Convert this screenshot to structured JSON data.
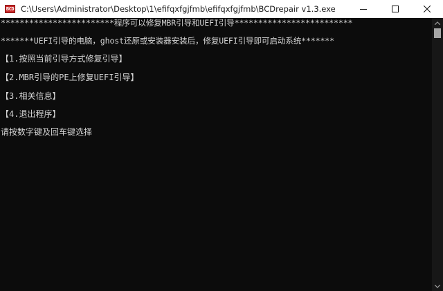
{
  "window": {
    "app_icon_text": "BCD",
    "title": "C:\\Users\\Administrator\\Desktop\\1\\efifqxfgjfmb\\efifqxfgjfmb\\BCDrepair v1.3.exe",
    "controls": {
      "minimize": "minimize-icon",
      "maximize": "maximize-icon",
      "close": "close-icon"
    }
  },
  "console": {
    "lines": [
      "************************程序可以修复MBR引导和UEFI引导*************************",
      "*******UEFI引导的电脑，ghost还原或安装器安装后，修复UEFI引导即可启动系统*******",
      "【1.按照当前引导方式修复引导】",
      "【2.MBR引导的PE上修复UEFI引导】",
      "【3.相关信息】",
      "【4.退出程序】",
      "请按数字键及回车键选择"
    ]
  },
  "colors": {
    "console_background": "#0c0c0c",
    "console_text": "#d4d4d4",
    "titlebar_background": "#ffffff",
    "scrollbar_track": "#171717",
    "scrollbar_thumb": "#a6a6a6",
    "icon_red": "#cc2b2b"
  }
}
